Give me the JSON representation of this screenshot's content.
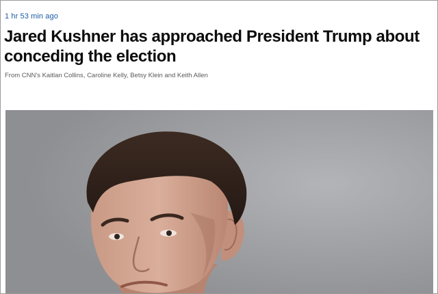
{
  "article": {
    "timestamp": "1 hr 53 min ago",
    "headline": "Jared Kushner has approached President Trump about conceding the election",
    "byline": "From CNN's Kaitlan Collins, Caroline Kelly, Betsy Klein and Keith Allen"
  },
  "colors": {
    "timestamp": "#1a5aa6",
    "headline": "#0c0c0c",
    "byline": "#5a5a5a",
    "photo_background": "#9c9da0"
  }
}
